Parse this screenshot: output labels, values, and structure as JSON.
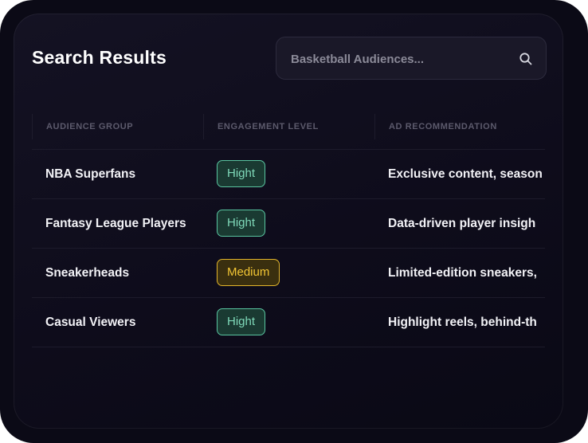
{
  "header": {
    "title": "Search Results"
  },
  "search": {
    "placeholder": "Basketball Audiences...",
    "icon": "search-icon"
  },
  "table": {
    "columns": [
      "AUDIENCE GROUP",
      "ENGAGEMENT LEVEL",
      "AD RECOMMENDATION"
    ],
    "rows": [
      {
        "audience": "NBA Superfans",
        "engagement": "Hight",
        "recommendation": "Exclusive content, season"
      },
      {
        "audience": "Fantasy League Players",
        "engagement": "Hight",
        "recommendation": "Data-driven player insigh"
      },
      {
        "audience": "Sneakerheads",
        "engagement": "Medium",
        "recommendation": "Limited-edition sneakers,"
      },
      {
        "audience": "Casual Viewers",
        "engagement": "Hight",
        "recommendation": "Highlight reels, behind-th"
      }
    ]
  },
  "colors": {
    "background": "#0b0a16",
    "high_badge": "#59c5a0",
    "medium_badge": "#e2b52a"
  }
}
